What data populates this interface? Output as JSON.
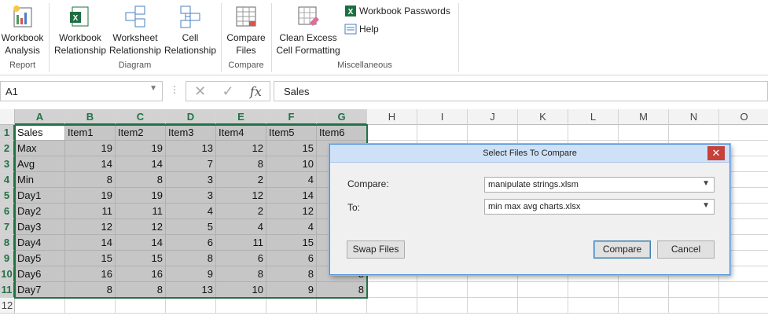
{
  "ribbon": {
    "groups": [
      {
        "label": "Report",
        "buttons": [
          {
            "label1": "Workbook",
            "label2": "Analysis"
          }
        ]
      },
      {
        "label": "Diagram",
        "buttons": [
          {
            "label1": "Workbook",
            "label2": "Relationship"
          },
          {
            "label1": "Worksheet",
            "label2": "Relationship"
          },
          {
            "label1": "Cell",
            "label2": "Relationship"
          }
        ]
      },
      {
        "label": "Compare",
        "buttons": [
          {
            "label1": "Compare",
            "label2": "Files"
          }
        ]
      },
      {
        "label": "Miscellaneous",
        "buttons": [
          {
            "label1": "Clean Excess",
            "label2": "Cell Formatting"
          }
        ]
      }
    ],
    "small_buttons": [
      "Workbook Passwords",
      "Help"
    ]
  },
  "formula_bar": {
    "name_box": "A1",
    "formula": "Sales",
    "fx": "fx"
  },
  "grid": {
    "columns": [
      "A",
      "B",
      "C",
      "D",
      "E",
      "F",
      "G",
      "H",
      "I",
      "J",
      "K",
      "L",
      "M",
      "N",
      "O"
    ],
    "rows": [
      "1",
      "2",
      "3",
      "4",
      "5",
      "6",
      "7",
      "8",
      "9",
      "10",
      "11",
      "12"
    ],
    "header_row": [
      "Sales",
      "Item1",
      "Item2",
      "Item3",
      "Item4",
      "Item5",
      "Item6"
    ],
    "data": [
      {
        "label": "Max",
        "values": [
          "19",
          "19",
          "13",
          "12",
          "15",
          ""
        ]
      },
      {
        "label": "Avg",
        "values": [
          "14",
          "14",
          "7",
          "8",
          "10",
          ""
        ]
      },
      {
        "label": "Min",
        "values": [
          "8",
          "8",
          "3",
          "2",
          "4",
          ""
        ]
      },
      {
        "label": "Day1",
        "values": [
          "19",
          "19",
          "3",
          "12",
          "14",
          ""
        ]
      },
      {
        "label": "Day2",
        "values": [
          "11",
          "11",
          "4",
          "2",
          "12",
          ""
        ]
      },
      {
        "label": "Day3",
        "values": [
          "12",
          "12",
          "5",
          "4",
          "4",
          ""
        ]
      },
      {
        "label": "Day4",
        "values": [
          "14",
          "14",
          "6",
          "11",
          "15",
          ""
        ]
      },
      {
        "label": "Day5",
        "values": [
          "15",
          "15",
          "8",
          "6",
          "6",
          ""
        ]
      },
      {
        "label": "Day6",
        "values": [
          "16",
          "16",
          "9",
          "8",
          "8",
          "8"
        ]
      },
      {
        "label": "Day7",
        "values": [
          "8",
          "8",
          "13",
          "10",
          "9",
          "8"
        ]
      }
    ]
  },
  "dialog": {
    "title": "Select Files To Compare",
    "close_glyph": "✕",
    "compare_label": "Compare:",
    "compare_value": "manipulate strings.xlsm",
    "to_label": "To:",
    "to_value": "min max avg charts.xlsx",
    "swap_label": "Swap Files",
    "compare_button": "Compare",
    "cancel_button": "Cancel"
  },
  "colors": {
    "accent": "#217346",
    "selection": "#c6c6c6",
    "dialog_title": "#cfe1f6",
    "close": "#c7403a"
  }
}
